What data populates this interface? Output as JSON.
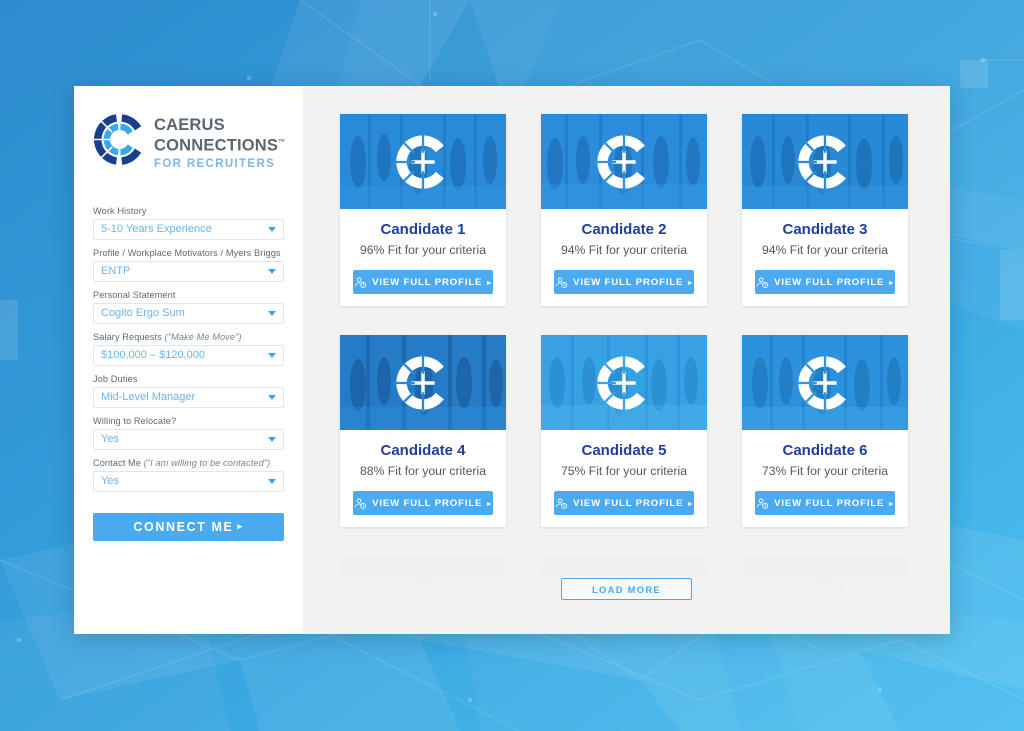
{
  "brand": {
    "logo_icon": "caerus-c-logo-icon",
    "name_line1": "CAERUS",
    "name_line2": "CONNECTIONS",
    "trademark": "™",
    "tagline": "FOR RECRUITERS",
    "colors": {
      "navy": "#21409a",
      "accent_blue": "#49aaf0",
      "light_blue": "#6cb4ec",
      "text_gray": "#5c6670",
      "panel_bg": "#f2f2f2",
      "page_bg_top": "#2f8fd0",
      "page_bg_bottom": "#49bdee"
    }
  },
  "sidebar": {
    "fields": [
      {
        "label": "Work History",
        "hint": "",
        "value": "5-10 Years Experience",
        "name": "work-history"
      },
      {
        "label": "Profile / Workplace Motivators / Myers Briggs",
        "hint": "",
        "value": "ENTP",
        "name": "profile-motivators"
      },
      {
        "label": "Personal Statement",
        "hint": "",
        "value": "Cogito Ergo Sum",
        "name": "personal-statement"
      },
      {
        "label": "Salary Requests ",
        "hint": "(\"Make Me Move\")",
        "value": "$100,000 – $120,000",
        "name": "salary-requests"
      },
      {
        "label": "Job Duties",
        "hint": "",
        "value": "Mid-Level Manager",
        "name": "job-duties"
      },
      {
        "label": "Willing to Relocate?",
        "hint": "",
        "value": "Yes",
        "name": "willing-to-relocate"
      },
      {
        "label": "Contact Me ",
        "hint": "(\"I am willing to be contacted\")",
        "value": "Yes",
        "name": "contact-me"
      }
    ],
    "connect_button": {
      "label": "CONNECT ME",
      "arrow": "▸"
    }
  },
  "results": {
    "button_label": "VIEW FULL PROFILE",
    "button_arrow": "▸",
    "button_icon": "person-profile-icon",
    "candidates": [
      {
        "title": "Candidate 1",
        "fit": "96% Fit for your criteria",
        "tint": "#2d8fde"
      },
      {
        "title": "Candidate 2",
        "fit": "94% Fit for your criteria",
        "tint": "#2f92e0"
      },
      {
        "title": "Candidate 3",
        "fit": "94% Fit for your criteria",
        "tint": "#2b8ddd"
      },
      {
        "title": "Candidate 4",
        "fit": "88% Fit for your criteria",
        "tint": "#2b86d6"
      },
      {
        "title": "Candidate 5",
        "fit": "75% Fit for your criteria",
        "tint": "#3aa5e6"
      },
      {
        "title": "Candidate 6",
        "fit": "73% Fit for your criteria",
        "tint": "#3196e2"
      }
    ],
    "load_more": {
      "label": "LOAD MORE"
    }
  }
}
